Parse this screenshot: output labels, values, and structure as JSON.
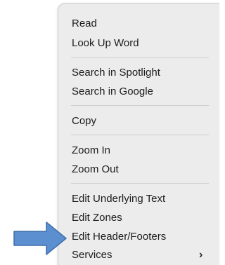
{
  "context_menu": {
    "groups": [
      {
        "items": [
          {
            "label": "Read"
          },
          {
            "label": "Look Up Word"
          }
        ]
      },
      {
        "items": [
          {
            "label": "Search in Spotlight"
          },
          {
            "label": "Search in Google"
          }
        ]
      },
      {
        "items": [
          {
            "label": "Copy"
          }
        ]
      },
      {
        "items": [
          {
            "label": "Zoom In"
          },
          {
            "label": "Zoom Out"
          }
        ]
      },
      {
        "items": [
          {
            "label": "Edit Underlying Text"
          },
          {
            "label": "Edit Zones"
          },
          {
            "label": "Edit Header/Footers"
          },
          {
            "label": "Services",
            "submenu_indicator": "›"
          }
        ]
      }
    ]
  },
  "annotation": {
    "arrow_color": "#5b8fd0",
    "arrow_outline": "#3e6fa9",
    "icon": "arrow-right-icon"
  }
}
